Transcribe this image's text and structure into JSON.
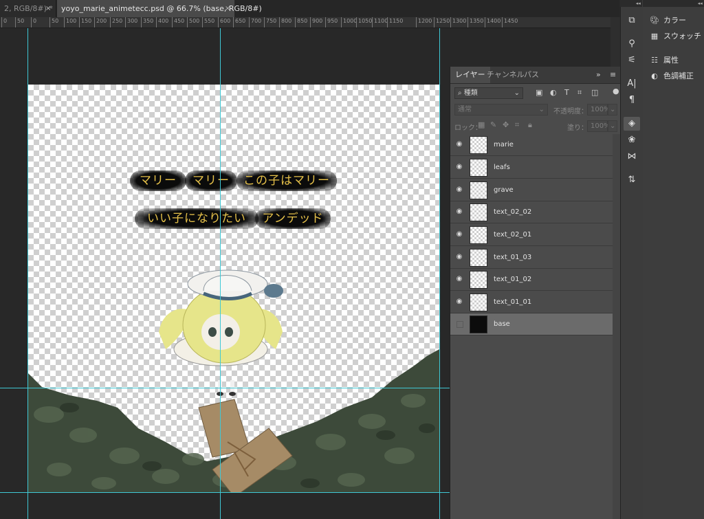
{
  "tabs": [
    {
      "label": "2, RGB/8#) *",
      "close": "×"
    },
    {
      "label": "yoyo_marie_animetecc.psd @ 66.7% (base, RGB/8#)",
      "close": "×"
    }
  ],
  "ruler": [
    "0",
    "50",
    "0",
    "50",
    "100",
    "150",
    "200",
    "250",
    "300",
    "350",
    "400",
    "450",
    "500",
    "550",
    "600",
    "650",
    "700",
    "750",
    "800",
    "850",
    "900",
    "950",
    "1000",
    "1050",
    "1100",
    "1150",
    "1200",
    "1250",
    "1300",
    "1350",
    "1400",
    "1450"
  ],
  "canvas": {
    "line1": [
      "マリー",
      "マリー",
      "この子はマリー"
    ],
    "line2": [
      "いい子になりたい",
      "アンデッド"
    ]
  },
  "layers_panel": {
    "tabs": [
      "レイヤー",
      "チャンネル",
      "パス"
    ],
    "menu_expand": "»",
    "filter_label": "種類",
    "blend_mode": "通常",
    "opacity_label": "不透明度：",
    "opacity_value": "100%",
    "lock_label": "ロック：",
    "fill_label": "塗り：",
    "fill_value": "100%",
    "layers": [
      {
        "name": "marie",
        "visible": true,
        "selected": false
      },
      {
        "name": "leafs",
        "visible": true,
        "selected": false
      },
      {
        "name": "grave",
        "visible": true,
        "selected": false
      },
      {
        "name": "text_02_02",
        "visible": true,
        "selected": false
      },
      {
        "name": "text_02_01",
        "visible": true,
        "selected": false
      },
      {
        "name": "text_01_03",
        "visible": true,
        "selected": false
      },
      {
        "name": "text_01_02",
        "visible": true,
        "selected": false
      },
      {
        "name": "text_01_01",
        "visible": true,
        "selected": false
      },
      {
        "name": "base",
        "visible": false,
        "selected": true
      }
    ]
  },
  "right_panel": {
    "items": [
      {
        "label": "カラー",
        "icon": "palette-icon"
      },
      {
        "label": "スウォッチ",
        "icon": "swatches-icon"
      },
      {
        "label": "属性",
        "icon": "properties-icon"
      },
      {
        "label": "色調補正",
        "icon": "adjustments-icon"
      }
    ]
  },
  "colors": {
    "guide": "#3fc9d6",
    "bubble_text": "#e6c14a",
    "selected_layer": "#6b6b6b"
  }
}
